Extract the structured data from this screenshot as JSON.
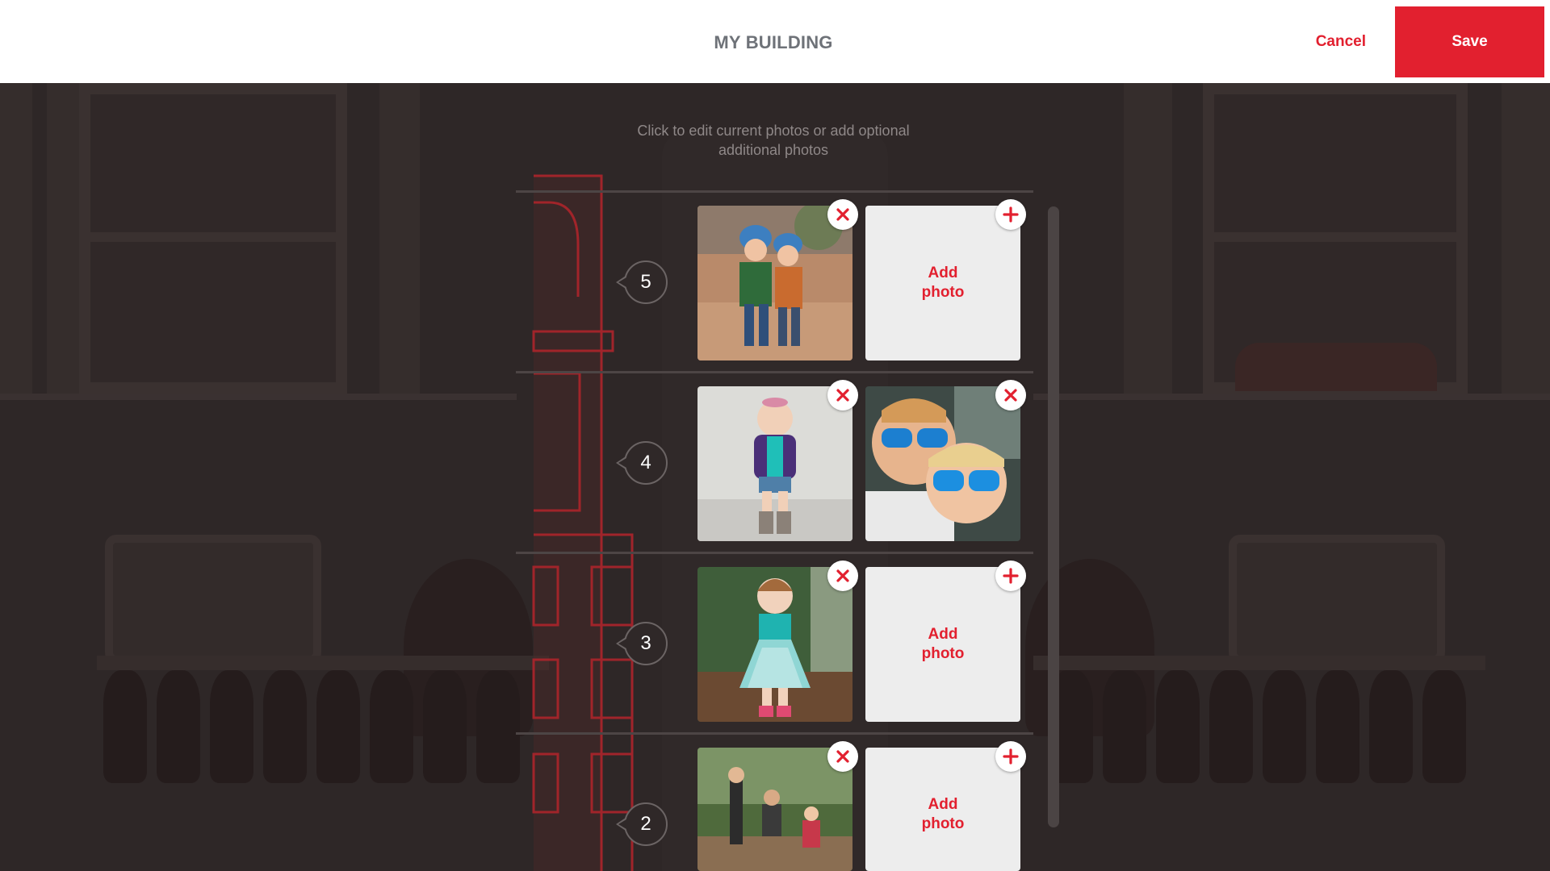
{
  "header": {
    "title": "MY BUILDING",
    "cancel_label": "Cancel",
    "save_label": "Save"
  },
  "instruction": "Click to edit current photos or add optional additional photos",
  "colors": {
    "accent": "#e2202f",
    "header_bg": "#ffffff",
    "title_text": "#6e7278",
    "page_bg": "#2e2727"
  },
  "floors": [
    {
      "number": "5",
      "slots": [
        {
          "type": "photo",
          "alt": "two children in helmets",
          "action_icon": "remove-icon"
        },
        {
          "type": "add",
          "label": "Add photo",
          "action_icon": "add-icon"
        }
      ]
    },
    {
      "number": "4",
      "slots": [
        {
          "type": "photo",
          "alt": "toddler with pacifier",
          "action_icon": "remove-icon"
        },
        {
          "type": "photo",
          "alt": "two boys in blue sunglasses",
          "action_icon": "remove-icon"
        }
      ]
    },
    {
      "number": "3",
      "slots": [
        {
          "type": "photo",
          "alt": "girl in teal dress",
          "action_icon": "remove-icon"
        },
        {
          "type": "add",
          "label": "Add photo",
          "action_icon": "add-icon"
        }
      ]
    },
    {
      "number": "2",
      "slots": [
        {
          "type": "photo",
          "alt": "family outdoors in woods",
          "action_icon": "remove-icon"
        },
        {
          "type": "add",
          "label": "Add photo",
          "action_icon": "add-icon"
        }
      ]
    }
  ]
}
